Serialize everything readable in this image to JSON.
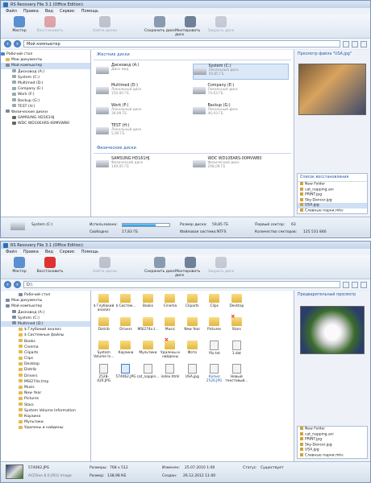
{
  "window1": {
    "title": "RS Recovery File 3.1 (Office Edition)",
    "menu": [
      "Файл",
      "Правка",
      "Вид",
      "Сервис",
      "Помощь"
    ],
    "toolbar": [
      "Мастер",
      "Восстановить",
      "Найти диски",
      "Сохранить диск",
      "Монтировать диск",
      "Закрыть диск"
    ],
    "address": "Мой компьютер",
    "tree": [
      "Рабочий стол",
      "Мои документы",
      "Мой компьютер",
      "Дисковод (A:)",
      "System (C:)",
      "Multimed (D:)",
      "Company (E:)",
      "Work (F:)",
      "Backup (G:)",
      "TEST (H:)",
      "Физические диски",
      "SAMSUNG HD161HJ",
      "WDC WD10EARS-00MVWB0"
    ],
    "hdd_header": "Жесткие диски",
    "drives": [
      {
        "name": "Дисковод (A:)",
        "sub": "Диск мед"
      },
      {
        "name": "System (C:)",
        "sub": "Локальный диск",
        "size": "59,85 ГБ"
      },
      {
        "name": "Multimed (D:)",
        "sub": "Локальный диск",
        "size": "150,00 ГБ"
      },
      {
        "name": "Company (E:)",
        "sub": "Локальный диск",
        "size": "74,63 ГБ"
      },
      {
        "name": "Work (F:)",
        "sub": "Локальный диск",
        "size": "39,99 ГБ"
      },
      {
        "name": "Backup (G:)",
        "sub": "Локальный диск",
        "size": "46,93 ГБ"
      },
      {
        "name": "TEST (H:)",
        "sub": "Локальный диск",
        "size": "5,99 ГБ"
      }
    ],
    "phys_header": "Физические диски",
    "phys": [
      {
        "name": "SAMSUNG HD161HJ",
        "sub": "Физический диск",
        "size": "149,05 ГБ"
      },
      {
        "name": "WDC WD10EARS-00MVWB0",
        "sub": "Физический диск",
        "size": "298,09 ГБ"
      }
    ],
    "preview_title": "Просмотр файла \"USA.jpg\"",
    "rec_title": "Список восстановления",
    "rec": [
      "New Folder",
      "cat_napping.avi",
      "PRINT.jpg",
      "Sky-Dancer.jpg",
      "USA.jpg",
      "Славные парни.mkv"
    ],
    "status": {
      "disk": "System (C:)",
      "used_label": "Использовано:",
      "free_label": "Свободно:",
      "free": "17,83 ГБ",
      "size_label": "Размер диска:",
      "size": "59,85 ГБ",
      "fs_label": "Файловая система:",
      "fs": "NTFS",
      "first_label": "Первый сектор:",
      "first": "63",
      "count_label": "Количество секторов:",
      "count": "125 531 846",
      "used_fraction": 0.7
    }
  },
  "window2": {
    "title": "RS Recovery File 3.1 (Office Edition)",
    "menu": [
      "Файл",
      "Правка",
      "Вид",
      "Сервис",
      "Помощь"
    ],
    "toolbar": [
      "Мастер",
      "Восстановить",
      "Найти диски",
      "Сохранить диск",
      "Монтировать диск",
      "Закрыть диск"
    ],
    "address": "D:\\",
    "tree": [
      "Рабочий стол",
      "Мои документы",
      "Мой компьютер",
      "Дисковод (A:)",
      "System (C:)",
      "Multimed (D:)",
      "$ Глубокий анализ",
      "$ Системные файлы",
      "Books",
      "Cinema",
      "Cliparts",
      "Clips",
      "Desktop",
      "Distrib",
      "Drivers",
      "MSI274x.tmp",
      "Music",
      "New Year",
      "Pictures",
      "Stars",
      "System Volume Information",
      "Корзина",
      "Мультики",
      "Удалены и найдены"
    ],
    "files": [
      {
        "n": "$ Глубокий анализ",
        "t": "f"
      },
      {
        "n": "$ Систем...",
        "t": "f"
      },
      {
        "n": "Books",
        "t": "f"
      },
      {
        "n": "Cinema",
        "t": "f"
      },
      {
        "n": "Cliparts",
        "t": "f"
      },
      {
        "n": "Clips",
        "t": "f"
      },
      {
        "n": "Desktop",
        "t": "f"
      },
      {
        "n": "",
        "t": "x"
      },
      {
        "n": "",
        "t": "x"
      },
      {
        "n": "Distrib",
        "t": "f"
      },
      {
        "n": "Drivers",
        "t": "f"
      },
      {
        "n": "MSI274x.t...",
        "t": "f"
      },
      {
        "n": "Music",
        "t": "f"
      },
      {
        "n": "New Year",
        "t": "f"
      },
      {
        "n": "Pictures",
        "t": "f"
      },
      {
        "n": "Stars",
        "t": "d"
      },
      {
        "n": "",
        "t": "x"
      },
      {
        "n": "",
        "t": "x"
      },
      {
        "n": "System Volume In...",
        "t": "f"
      },
      {
        "n": "Корзина",
        "t": "r"
      },
      {
        "n": "Мультики",
        "t": "f"
      },
      {
        "n": "Удалены и найдены",
        "t": "d"
      },
      {
        "n": "Фото",
        "t": "f"
      },
      {
        "n": "!fix.txt",
        "t": "i"
      },
      {
        "n": "1.dat",
        "t": "i"
      },
      {
        "n": "",
        "t": "x"
      },
      {
        "n": "",
        "t": "x"
      },
      {
        "n": "2528-420.JPG",
        "t": "i"
      },
      {
        "n": "574062.JPG",
        "t": "s"
      },
      {
        "n": "cat_nappin...",
        "t": "i"
      },
      {
        "n": "index.html",
        "t": "i"
      },
      {
        "n": "USA.jpg",
        "t": "i"
      },
      {
        "n": "Копия 2526.JPG",
        "t": "b"
      },
      {
        "n": "Новый текстовый...",
        "t": "i"
      },
      {
        "n": "",
        "t": "x"
      },
      {
        "n": "",
        "t": "x"
      }
    ],
    "preview_title": "Предварительный просмотр",
    "rec": [
      "New Folder",
      "cat_napping.avi",
      "PRINT.jpg",
      "Sky-Dancer.jpg",
      "USA.jpg",
      "Славные парни.mkv"
    ],
    "status": {
      "file": "574062.JPG",
      "type": "ACDSee 8.0 JPEG Image",
      "size_label": "Размеры:",
      "size": "768 x 512",
      "weight_label": "Размер:",
      "weight": "138,98 КБ",
      "changed_label": "Изменен:",
      "changed": "25.07.2010 1:00",
      "created_label": "Создан:",
      "created": "26.12.2012 11:00",
      "state_label": "Статус:",
      "state": "Существует"
    }
  }
}
